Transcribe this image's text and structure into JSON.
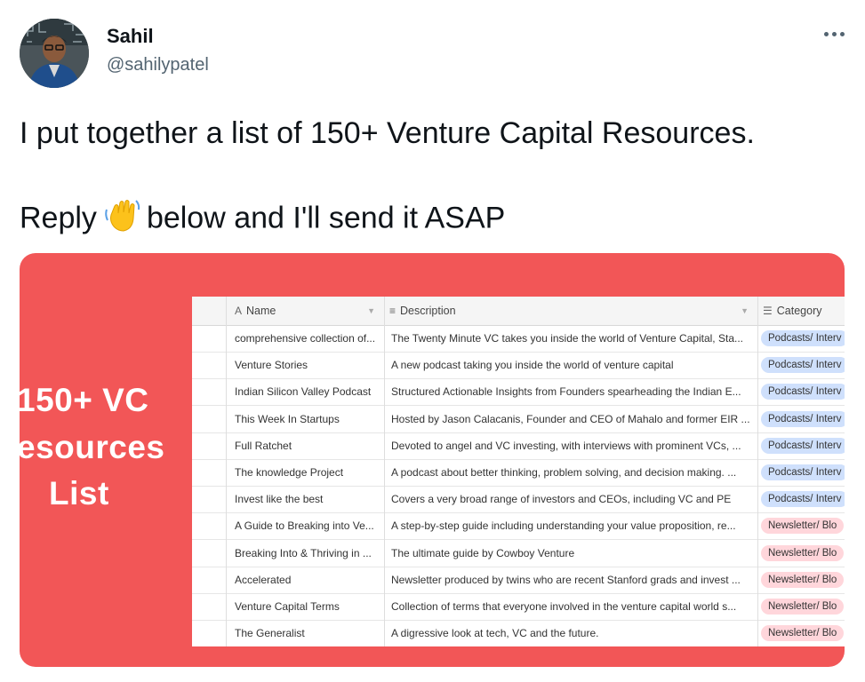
{
  "author": {
    "name": "Sahil",
    "handle": "@sahilypatel"
  },
  "tweet": {
    "line1": "I put together a list of 150+ Venture Capital Resources.",
    "line2_before": "Reply",
    "line2_emoji_icon": "waving-hand-icon",
    "line2_after": "below and I'll send it ASAP"
  },
  "media": {
    "background_color": "#f25657",
    "headline": [
      "150+ VC",
      "esources",
      "List"
    ],
    "table": {
      "columns": [
        {
          "icon": "A",
          "label": "Name"
        },
        {
          "icon": "≡",
          "label": "Description"
        },
        {
          "icon": "☰",
          "label": "Category"
        }
      ],
      "rows": [
        {
          "name": "comprehensive collection of...",
          "description": "The Twenty Minute VC takes you inside the world of Venture Capital, Sta...",
          "category": "Podcasts/ Interv",
          "color": "blue"
        },
        {
          "name": "Venture Stories",
          "description": "A new podcast taking you inside the world of venture capital",
          "category": "Podcasts/ Interv",
          "color": "blue"
        },
        {
          "name": "Indian Silicon Valley Podcast",
          "description": "Structured Actionable Insights from Founders spearheading the Indian E...",
          "category": "Podcasts/ Interv",
          "color": "blue"
        },
        {
          "name": "This Week In Startups",
          "description": "Hosted by Jason Calacanis, Founder and CEO of Mahalo and former EIR ...",
          "category": "Podcasts/ Interv",
          "color": "blue"
        },
        {
          "name": "Full Ratchet",
          "description": "Devoted to angel and VC investing, with interviews with prominent VCs, ...",
          "category": "Podcasts/ Interv",
          "color": "blue"
        },
        {
          "name": "The knowledge Project",
          "description": "A podcast about better thinking, problem solving, and decision making. ...",
          "category": "Podcasts/ Interv",
          "color": "blue"
        },
        {
          "name": "Invest like the best",
          "description": "Covers a very broad range of investors and CEOs, including VC and PE",
          "category": "Podcasts/ Interv",
          "color": "blue"
        },
        {
          "name": "A Guide to Breaking into Ve...",
          "description": "A step-by-step guide including understanding your value proposition, re...",
          "category": "Newsletter/ Blo",
          "color": "pink"
        },
        {
          "name": "Breaking Into & Thriving in ...",
          "description": "The ultimate guide by Cowboy Venture",
          "category": "Newsletter/ Blo",
          "color": "pink"
        },
        {
          "name": "Accelerated",
          "description": "Newsletter produced by twins who are recent Stanford grads and invest ...",
          "category": "Newsletter/ Blo",
          "color": "pink"
        },
        {
          "name": "Venture Capital Terms",
          "description": "Collection of terms that everyone involved in the venture capital world s...",
          "category": "Newsletter/ Blo",
          "color": "pink"
        },
        {
          "name": "The Generalist",
          "description": "A digressive look at tech, VC and the future.",
          "category": "Newsletter/ Blo",
          "color": "pink"
        }
      ]
    }
  }
}
